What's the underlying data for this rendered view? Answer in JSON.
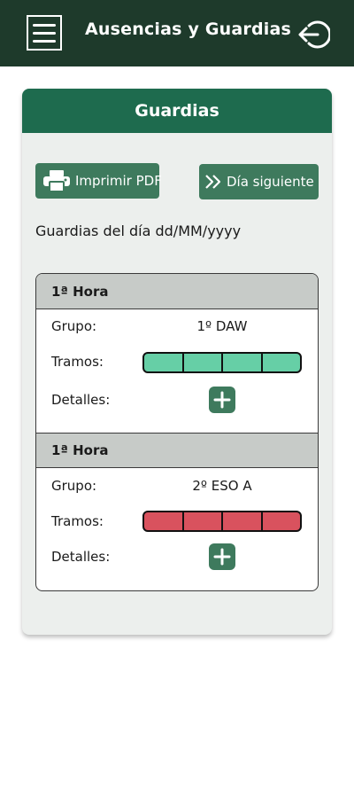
{
  "header": {
    "title": "Ausencias y Guardias",
    "menu_icon": "hamburger-menu-icon",
    "logout_icon": "logout-icon",
    "background_color": "#1e3a2b"
  },
  "panel": {
    "title": "Guardias",
    "header_color": "#1e6b4e",
    "print_button": {
      "label": "Imprimir PDF",
      "icon": "printer-icon"
    },
    "next_button": {
      "label": "Día siguiente",
      "icon": "double-chevron-right-icon"
    },
    "date_text": "Guardias del día dd/MM/yyyy"
  },
  "guardias": [
    {
      "hora": "1ª Hora",
      "grupo_label": "Grupo:",
      "grupo": "1º DAW",
      "tramos_label": "Tramos:",
      "tramos_color": "#66cfa6",
      "tramos_count": 4,
      "detalles_label": "Detalles:",
      "detalles_icon": "plus-icon"
    },
    {
      "hora": "1ª Hora",
      "grupo_label": "Grupo:",
      "grupo": "2º ESO A",
      "tramos_label": "Tramos:",
      "tramos_color": "#d9525e",
      "tramos_count": 4,
      "detalles_label": "Detalles:",
      "detalles_icon": "plus-icon"
    }
  ]
}
